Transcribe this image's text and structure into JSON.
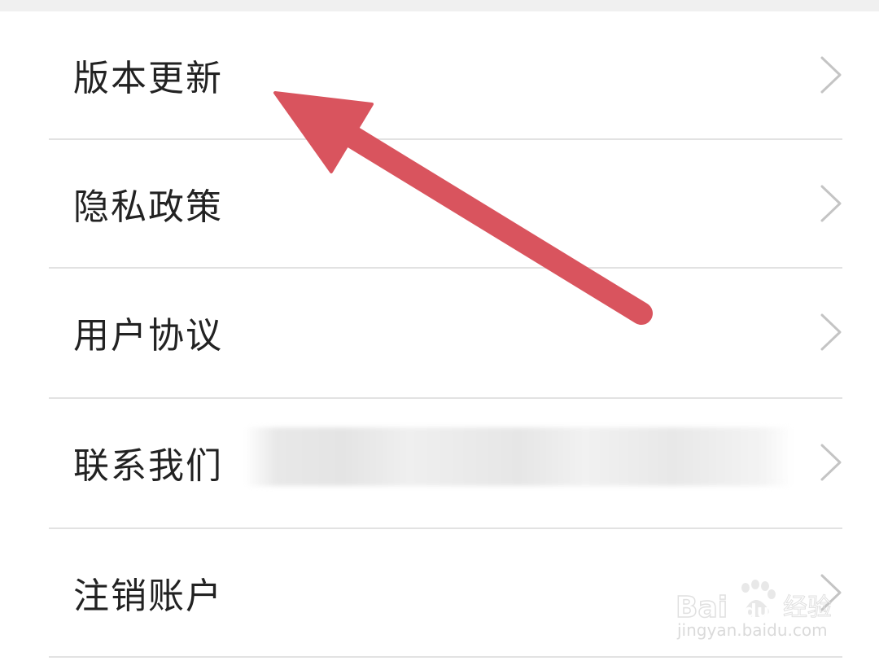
{
  "settings_list": {
    "items": [
      {
        "label": "版本更新",
        "icon": "chevron-right-icon"
      },
      {
        "label": "隐私政策",
        "icon": "chevron-right-icon"
      },
      {
        "label": "用户协议",
        "icon": "chevron-right-icon"
      },
      {
        "label": "联系我们",
        "icon": "chevron-right-icon",
        "value_redacted": true
      },
      {
        "label": "注销账户",
        "icon": "chevron-right-icon"
      }
    ]
  },
  "annotation": {
    "type": "arrow",
    "points_to": "版本更新",
    "color": "#d9545e"
  },
  "watermark": {
    "brand": "Baidu经验",
    "url": "jingyan.baidu.com"
  },
  "colors": {
    "background": "#ffffff",
    "text": "#222222",
    "divider": "#e2e2e2",
    "chevron": "#c4c4c4",
    "top_strip": "#f0f0f0"
  }
}
